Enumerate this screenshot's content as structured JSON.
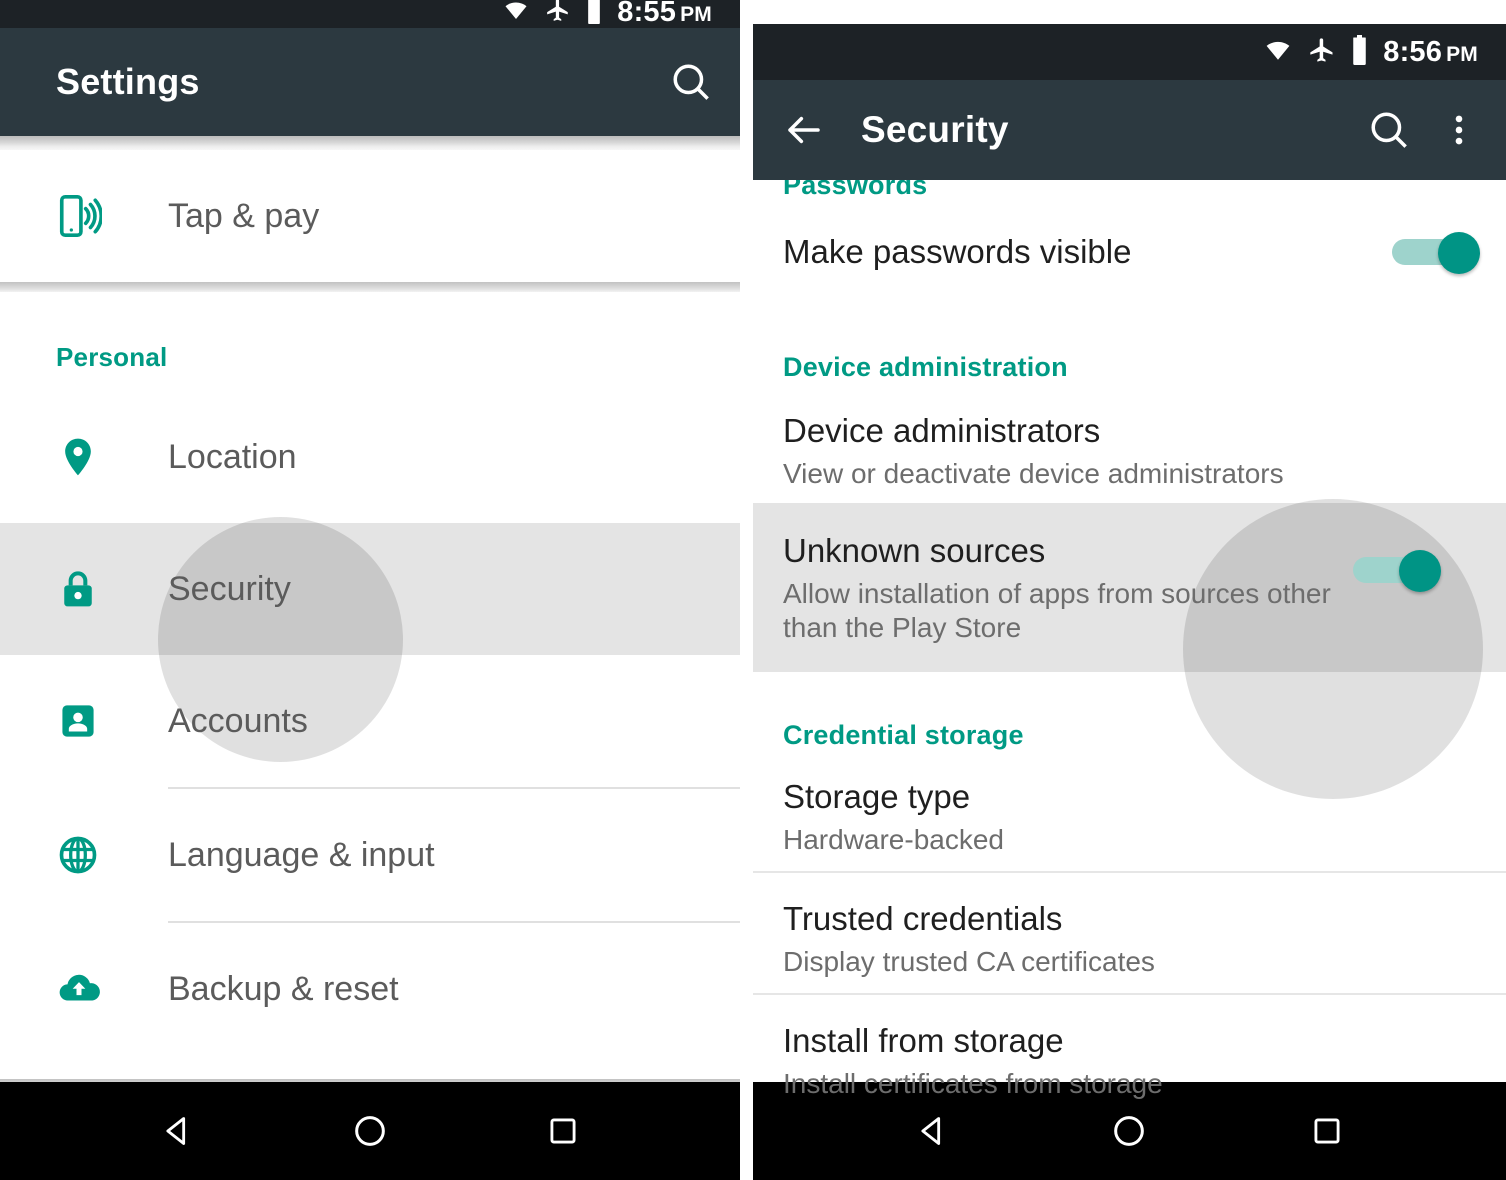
{
  "left_panel": {
    "statusbar": {
      "time": "8:55",
      "ampm": "PM",
      "icons": [
        "wifi-icon",
        "airplane-icon",
        "battery-icon"
      ]
    },
    "appbar": {
      "title": "Settings",
      "search_icon": "search-icon"
    },
    "top_items": [
      {
        "label": "Tap & pay",
        "icon": "nfc-phone-icon"
      }
    ],
    "section": {
      "header": "Personal",
      "items": [
        {
          "label": "Location",
          "icon": "location-pin-icon",
          "selected": false,
          "divider": false
        },
        {
          "label": "Security",
          "icon": "lock-icon",
          "selected": true,
          "divider": false
        },
        {
          "label": "Accounts",
          "icon": "account-icon",
          "selected": false,
          "divider": true
        },
        {
          "label": "Language & input",
          "icon": "globe-icon",
          "selected": false,
          "divider": true
        },
        {
          "label": "Backup & reset",
          "icon": "cloud-upload-icon",
          "selected": false,
          "divider": false
        }
      ]
    },
    "navbar": {
      "back": "nav-back-triangle-icon",
      "home": "nav-home-circle-icon",
      "recents": "nav-recents-square-icon"
    }
  },
  "right_panel": {
    "statusbar": {
      "time": "8:56",
      "ampm": "PM",
      "icons": [
        "wifi-icon",
        "airplane-icon",
        "battery-icon"
      ]
    },
    "appbar": {
      "back_icon": "arrow-back-icon",
      "title": "Security",
      "search_icon": "search-icon",
      "overflow_icon": "more-vert-icon"
    },
    "sections": [
      {
        "header": "Passwords",
        "rows": [
          {
            "title": "Make passwords visible",
            "subtitle": "",
            "toggle": true,
            "toggle_on": true,
            "highlight": false,
            "divider_after": false
          }
        ]
      },
      {
        "header": "Device administration",
        "rows": [
          {
            "title": "Device administrators",
            "subtitle": "View or deactivate device administrators",
            "toggle": false,
            "toggle_on": false,
            "highlight": false,
            "divider_after": false
          },
          {
            "title": "Unknown sources",
            "subtitle": "Allow installation of apps from sources other than the Play Store",
            "toggle": true,
            "toggle_on": true,
            "highlight": true,
            "divider_after": false
          }
        ]
      },
      {
        "header": "Credential storage",
        "rows": [
          {
            "title": "Storage type",
            "subtitle": "Hardware-backed",
            "toggle": false,
            "toggle_on": false,
            "highlight": false,
            "divider_after": true
          },
          {
            "title": "Trusted credentials",
            "subtitle": "Display trusted CA certificates",
            "toggle": false,
            "toggle_on": false,
            "highlight": false,
            "divider_after": true
          },
          {
            "title": "Install from storage",
            "subtitle": "Install certificates from storage",
            "toggle": false,
            "toggle_on": false,
            "highlight": false,
            "divider_after": false
          }
        ]
      }
    ],
    "navbar": {
      "back": "nav-back-triangle-icon",
      "home": "nav-home-circle-icon",
      "recents": "nav-recents-square-icon"
    }
  },
  "colors": {
    "accent_teal": "#009a84",
    "appbar_dark": "#2c3940",
    "statusbar_dark": "#1d2226",
    "highlight_gray": "#e4e4e4",
    "toggle_track": "#9ed3cc",
    "toggle_thumb": "#009485",
    "navbar_black": "#000000"
  }
}
